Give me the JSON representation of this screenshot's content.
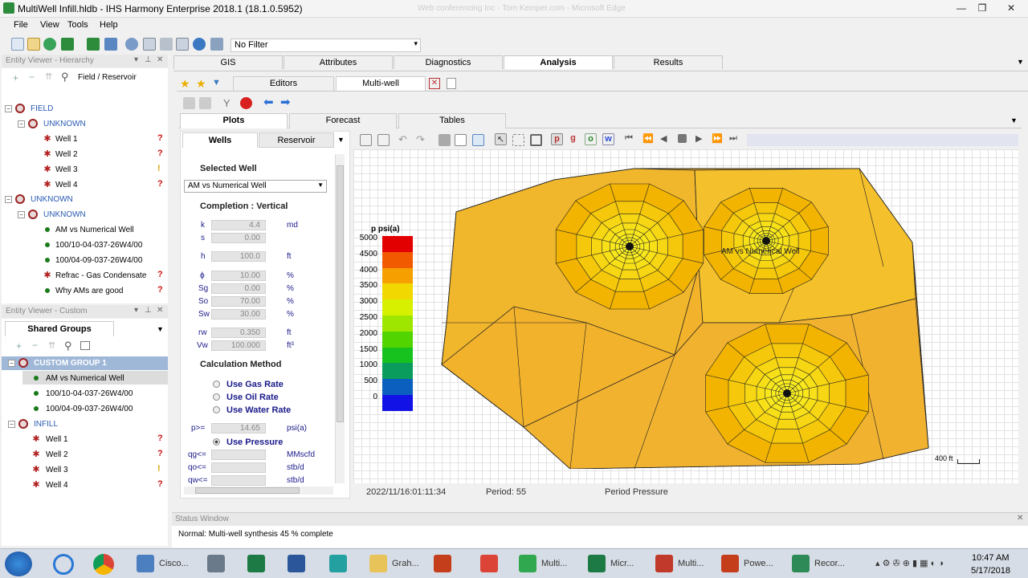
{
  "window": {
    "title": "MultiWell Infill.hldb - IHS Harmony Enterprise 2018.1  (18.1.0.5952)",
    "ghost_title": "Web conferencing Inc - Tom Kemper.com - Microsoft Edge"
  },
  "menu": [
    "File",
    "View",
    "Tools",
    "Help"
  ],
  "filter": {
    "value": "No Filter"
  },
  "hierarchy": {
    "title": "Entity Viewer - Hierarchy",
    "search_label": "Field / Reservoir",
    "nodes": [
      {
        "label": "FIELD"
      },
      {
        "label": "UNKNOWN"
      },
      {
        "label": "Well 1"
      },
      {
        "label": "Well 2"
      },
      {
        "label": "Well 3"
      },
      {
        "label": "Well 4"
      },
      {
        "label": "UNKNOWN"
      },
      {
        "label": "UNKNOWN"
      },
      {
        "label": "AM vs Numerical Well"
      },
      {
        "label": "100/10-04-037-26W4/00"
      },
      {
        "label": "100/04-09-037-26W4/00"
      },
      {
        "label": "Refrac - Gas Condensate"
      },
      {
        "label": "Why AMs are good"
      }
    ]
  },
  "custom": {
    "title": "Entity Viewer - Custom",
    "tab": "Shared Groups",
    "nodes": [
      {
        "label": "CUSTOM GROUP 1"
      },
      {
        "label": "AM vs Numerical Well"
      },
      {
        "label": "100/10-04-037-26W4/00"
      },
      {
        "label": "100/04-09-037-26W4/00"
      },
      {
        "label": "INFILL"
      },
      {
        "label": "Well 1"
      },
      {
        "label": "Well 2"
      },
      {
        "label": "Well 3"
      },
      {
        "label": "Well 4"
      }
    ]
  },
  "main_tabs": [
    "GIS",
    "Attributes",
    "Diagnostics",
    "Analysis",
    "Results"
  ],
  "sub_tabs": [
    "Editors",
    "Multi-well"
  ],
  "plot_tabs": [
    "Plots",
    "Forecast",
    "Tables"
  ],
  "side_tabs": [
    "Wells",
    "Reservoir"
  ],
  "form": {
    "selected_well_header": "Selected Well",
    "selected_well": "AM vs Numerical Well",
    "completion_header": "Completion : Vertical",
    "rows": [
      {
        "sym": "k",
        "value": "4.4",
        "unit": "md"
      },
      {
        "sym": "s",
        "value": "0.00",
        "unit": ""
      },
      {
        "sym": "h",
        "value": "100.0",
        "unit": "ft"
      },
      {
        "sym": "ϕ",
        "value": "10.00",
        "unit": "%"
      },
      {
        "sym": "Sg",
        "value": "0.00",
        "unit": "%"
      },
      {
        "sym": "So",
        "value": "70.00",
        "unit": "%"
      },
      {
        "sym": "Sw",
        "value": "30.00",
        "unit": "%"
      },
      {
        "sym": "rw",
        "value": "0.350",
        "unit": "ft"
      },
      {
        "sym": "Vw",
        "value": "100.000",
        "unit": "ft³"
      }
    ],
    "calc_header": "Calculation Method",
    "radios": [
      "Use Gas Rate",
      "Use Oil Rate",
      "Use Water Rate"
    ],
    "p_row": {
      "sym": "p>=",
      "value": "14.65",
      "unit": "psi(a)"
    },
    "use_pressure": "Use Pressure",
    "rate_rows": [
      {
        "sym": "qg<=",
        "unit": "MMscfd"
      },
      {
        "sym": "qo<=",
        "unit": "stb/d"
      },
      {
        "sym": "qw<=",
        "unit": "stb/d"
      }
    ]
  },
  "plot": {
    "legend_title": "p psi(a)",
    "legend_ticks": [
      "5000",
      "4500",
      "4000",
      "3500",
      "3000",
      "2500",
      "2000",
      "1500",
      "1000",
      "500",
      "0"
    ],
    "legend_colors": [
      "#e30000",
      "#f25a00",
      "#f5a000",
      "#f0d800",
      "#d6f000",
      "#9ee600",
      "#52d400",
      "#17c21e",
      "#0a9c5c",
      "#0b5fbf",
      "#1212e6"
    ],
    "well_label": "AM vs Numerical Well",
    "scale_label": "400 ft",
    "fill_main": "#f2b22b"
  },
  "status": {
    "time": "2022/11/16:01:11:34",
    "period": "Period: 55",
    "mode": "Period Pressure"
  },
  "status_window": {
    "title": "Status Window",
    "message": "Normal: Multi-well synthesis 45 % complete"
  },
  "taskbar": {
    "items": [
      {
        "label": "Cisco...",
        "color": "#4c7fc0"
      },
      {
        "label": "",
        "color": "#6a7a8a"
      },
      {
        "label": "",
        "color": "#1e7a45"
      },
      {
        "label": "",
        "color": "#2b579a"
      },
      {
        "label": "",
        "color": "#24a0a0"
      },
      {
        "label": "Grah...",
        "color": "#e8c35a"
      },
      {
        "label": "",
        "color": "#c43e1c"
      },
      {
        "label": "",
        "color": "#db4437"
      },
      {
        "label": "Multi...",
        "color": "#2fa84f"
      },
      {
        "label": "Micr...",
        "color": "#1e7a45"
      },
      {
        "label": "Multi...",
        "color": "#c0392b"
      },
      {
        "label": "Powe...",
        "color": "#c43e1c"
      },
      {
        "label": "Recor...",
        "color": "#2e8b57"
      }
    ],
    "time": "10:47 AM",
    "date": "5/17/2018"
  }
}
